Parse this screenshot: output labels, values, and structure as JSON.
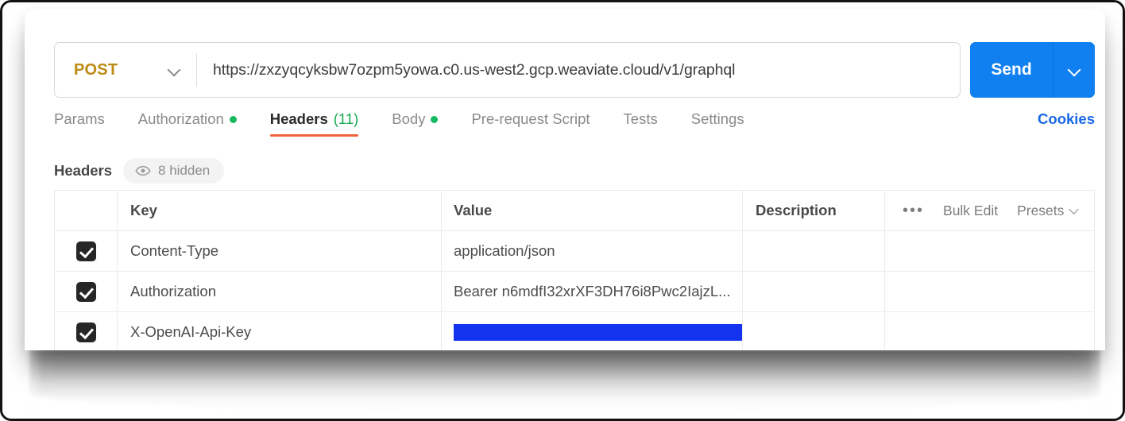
{
  "request_bar": {
    "method": "POST",
    "method_caret_icon": "chevron-down-icon",
    "url": "https://zxzyqcyksbw7ozpm5yowa.c0.us-west2.gcp.weaviate.cloud/v1/graphql",
    "url_placeholder": "Enter request URL",
    "send_label": "Send",
    "send_caret_icon": "chevron-down-icon",
    "accent_blue": "#1080f0",
    "method_color": "#bd8b13"
  },
  "tabs": [
    {
      "label": "Params",
      "badge": "",
      "active": false,
      "dot": false
    },
    {
      "label": "Authorization",
      "badge": "",
      "active": false,
      "dot": true
    },
    {
      "label": "Headers",
      "badge": "(11)",
      "active": true,
      "dot": false
    },
    {
      "label": "Body",
      "badge": "",
      "active": false,
      "dot": true
    },
    {
      "label": "Pre-request Script",
      "badge": "",
      "active": false,
      "dot": false
    },
    {
      "label": "Tests",
      "badge": "",
      "active": false,
      "dot": false
    },
    {
      "label": "Settings",
      "badge": "",
      "active": false,
      "dot": false
    }
  ],
  "cookies_link": "Cookies",
  "active_tab_underline_color": "#f0623a",
  "dot_color": "#16b95f",
  "headers_section": {
    "title": "Headers",
    "hidden_badge": {
      "icon": "eye-icon",
      "label": "8 hidden"
    }
  },
  "table": {
    "columns": [
      "Key",
      "Value",
      "Description"
    ],
    "tools": {
      "more_icon": "ellipsis-icon",
      "bulk_edit": "Bulk Edit",
      "presets": "Presets",
      "presets_caret_icon": "chevron-down-icon"
    },
    "rows": [
      {
        "checked": true,
        "key": "Content-Type",
        "value": "application/json",
        "redacted": false,
        "description": ""
      },
      {
        "checked": true,
        "key": "Authorization",
        "value": "Bearer n6mdfI32xrXF3DH76i8Pwc2IajzL...",
        "redacted": false,
        "description": ""
      },
      {
        "checked": true,
        "key": "X-OpenAI-Api-Key",
        "value": "",
        "redacted": true,
        "description": ""
      }
    ],
    "redaction_color": "#1433ee"
  }
}
